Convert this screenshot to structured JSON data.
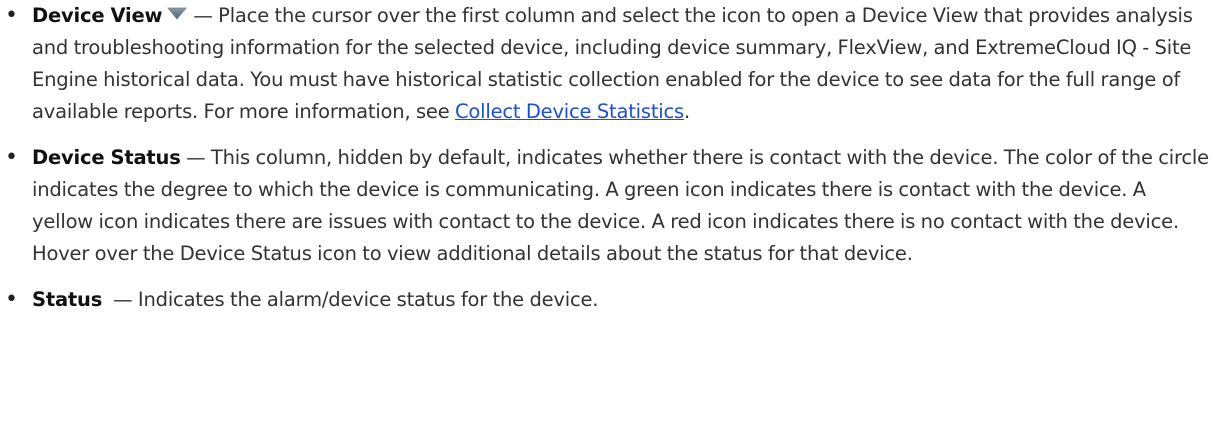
{
  "items": [
    {
      "term": "Device View",
      "icon": "triangle-down-icon",
      "text_before_link": "— Place the cursor over the first column and select the icon to open a Device View that provides analysis and troubleshooting information for the selected device, including device summary, FlexView, and ExtremeCloud IQ - Site Engine historical data. You must have historical statistic collection enabled for the device to see data for the full range of available reports. For more information, see ",
      "link_text": "Collect Device Statistics",
      "text_after_link": "."
    },
    {
      "term": "Device Status",
      "text": " — This column, hidden by default, indicates whether there is contact with the device. The color of the circle indicates the degree to which the device is communicating. A green icon indicates there is contact with the device. A yellow icon indicates there are issues with contact to the device. A red icon indicates there is no contact with the device. Hover over the Device Status icon to view additional details about the status for that device."
    },
    {
      "term": "Status",
      "text": "  — Indicates the alarm/device status for the device."
    }
  ],
  "colors": {
    "link": "#1a4fd6",
    "text": "#333333",
    "icon_top": "#8a9aa8",
    "icon_bottom": "#4e6478"
  }
}
